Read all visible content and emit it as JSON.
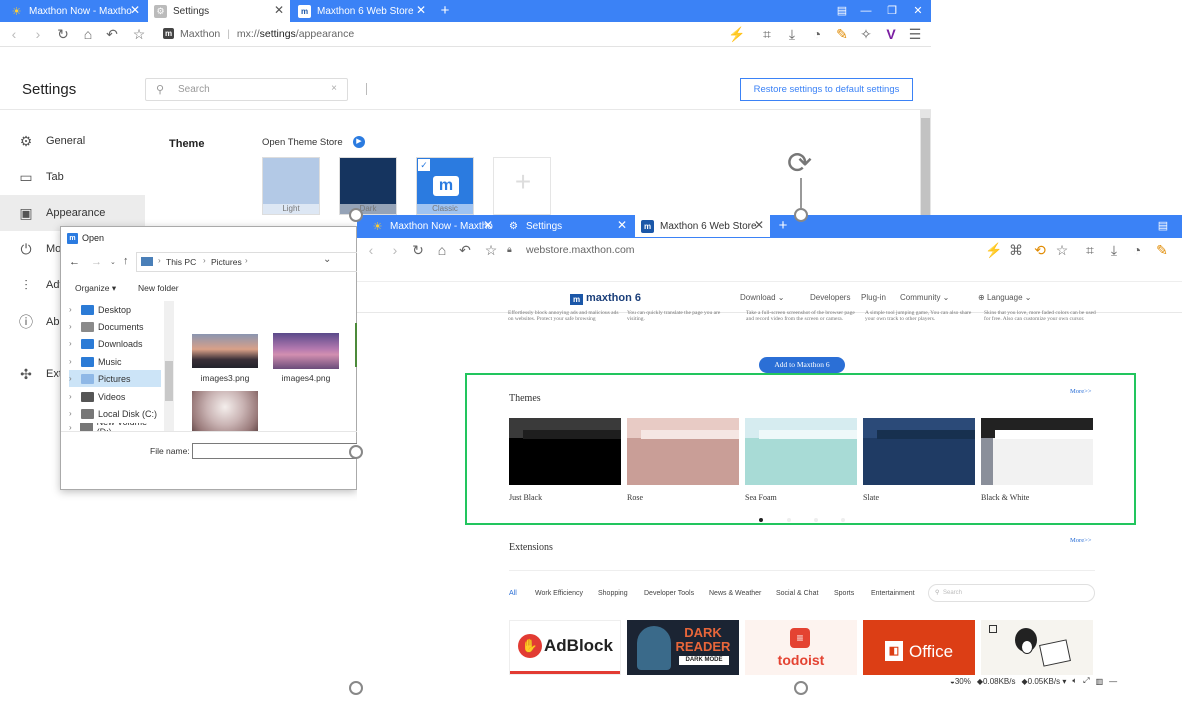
{
  "back_window": {
    "tabs": [
      {
        "label": "Maxthon Now - Maxtho",
        "icon": "sun-icon"
      },
      {
        "label": "Settings",
        "icon": "gear-icon"
      },
      {
        "label": "Maxthon 6 Web Store",
        "icon": "maxthon-icon"
      }
    ],
    "address": {
      "site": "Maxthon",
      "separator": "|",
      "url_prefix": "mx://",
      "url_bold": "settings",
      "url_suffix": "/appearance"
    },
    "settings": {
      "title": "Settings",
      "search_placeholder": "Search",
      "restore_button": "Restore settings to default settings",
      "sidebar": [
        {
          "label": "General",
          "icon": "gear-icon"
        },
        {
          "label": "Tab",
          "icon": "tab-icon"
        },
        {
          "label": "Appearance",
          "icon": "appearance-icon"
        },
        {
          "label": "Mo",
          "icon": "power-icon"
        },
        {
          "label": "Adv",
          "icon": "sliders-icon"
        },
        {
          "label": "Abo",
          "icon": "info-icon"
        },
        {
          "label": "Ext",
          "icon": "puzzle-icon"
        }
      ],
      "theme_heading": "Theme",
      "theme_store_link": "Open Theme Store",
      "themes": [
        {
          "label": "Light"
        },
        {
          "label": "Dark"
        },
        {
          "label": "Classic"
        }
      ]
    }
  },
  "dialog": {
    "title": "Open",
    "breadcrumb": [
      "This PC",
      "Pictures"
    ],
    "organize": "Organize ▾",
    "new_folder": "New folder",
    "tree": [
      {
        "label": "Desktop",
        "color": "#2b7bd6"
      },
      {
        "label": "Documents",
        "color": "#8a8a8a"
      },
      {
        "label": "Downloads",
        "color": "#2b7bd6"
      },
      {
        "label": "Music",
        "color": "#2b7bd6"
      },
      {
        "label": "Pictures",
        "color": "#8fb8e6"
      },
      {
        "label": "Videos",
        "color": "#555"
      },
      {
        "label": "Local Disk (C:)",
        "color": "#777"
      },
      {
        "label": "New Volume (D:)",
        "color": "#777"
      }
    ],
    "files": [
      {
        "name": "images3.png"
      },
      {
        "name": "images4.png"
      },
      {
        "name": ""
      }
    ],
    "filename_label": "File name:"
  },
  "front_window": {
    "tabs": [
      {
        "label": "Maxthon Now - Maxtho",
        "icon": "sun-icon"
      },
      {
        "label": "Settings",
        "icon": "gear-icon"
      },
      {
        "label": "Maxthon 6 Web Store",
        "icon": "maxthon-icon"
      }
    ],
    "url": "webstore.maxthon.com",
    "webstore": {
      "logo": "maxthon 6",
      "nav": [
        "Download",
        "Developers",
        "Plug-in",
        "Community",
        "Language"
      ],
      "feature_text": [
        "Effortlessly block annoying ads and malicious ads on websites. Protect your safe browsing",
        "You can quickly translate the page you are visiting.",
        "Take a full-screen screenshot of the browser page and record video from the screen or camera.",
        "A simple tool jumping game, You can also share your own track to other players.",
        "Skins that you love, more faded colors can be used for free. Also can customize your own cursor."
      ],
      "add_button": "Add to Maxthon 6",
      "themes_heading": "Themes",
      "more_themes": "More>>",
      "themes": [
        {
          "name": "Just Black",
          "bg": "#111111",
          "bar": "#3a3a3a"
        },
        {
          "name": "Rose",
          "bg": "#c99e97",
          "bar": "#e8cbc5"
        },
        {
          "name": "Sea Foam",
          "bg": "#a8dbd6",
          "bar": "#d6ecf0"
        },
        {
          "name": "Slate",
          "bg": "#1f3b64",
          "bar": "#2b4a78"
        },
        {
          "name": "Black & White",
          "bg": "#f2f2f2",
          "bar": "#222222"
        }
      ],
      "extensions_heading": "Extensions",
      "more_extensions": "More>>",
      "categories": [
        "All",
        "Work Efficiency",
        "Shopping",
        "Developer Tools",
        "News & Weather",
        "Social & Chat",
        "Sports",
        "Entertainment"
      ],
      "ext_search_placeholder": "Search",
      "extensions": [
        {
          "name": "AdBlock"
        },
        {
          "name": "DARK READER",
          "sub": "DARK MODE"
        },
        {
          "name": "todoist"
        },
        {
          "name": "Office"
        },
        {
          "name": ""
        }
      ]
    },
    "status": {
      "zoom": "30%",
      "down": "0.08KB/s",
      "up": "0.05KB/s"
    }
  },
  "colors": {
    "accent": "#3b82f6",
    "selection": "#22c55e"
  }
}
